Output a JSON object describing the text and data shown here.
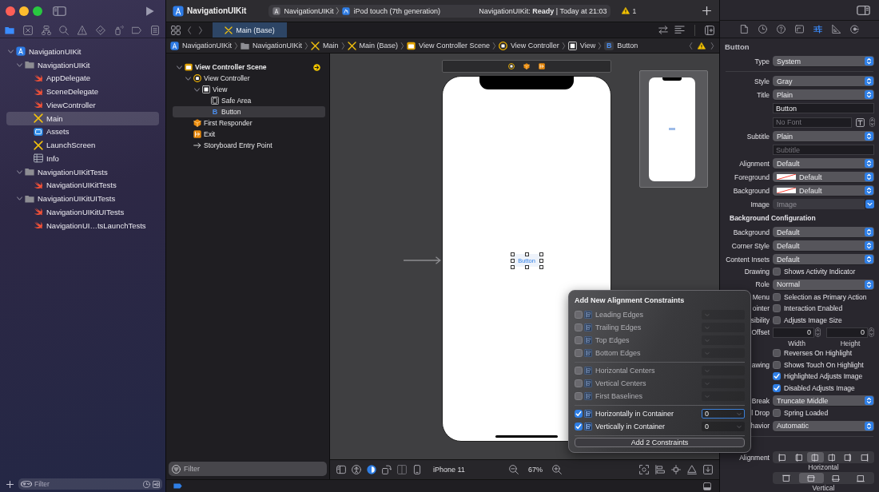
{
  "navigator": {
    "tabs": [
      {
        "kind": "project",
        "selected": true
      },
      {
        "kind": "source-control",
        "selected": false
      },
      {
        "kind": "symbols",
        "selected": false
      },
      {
        "kind": "find",
        "selected": false
      },
      {
        "kind": "issues",
        "selected": false
      },
      {
        "kind": "tests",
        "selected": false
      },
      {
        "kind": "debug",
        "selected": false
      },
      {
        "kind": "breakpoints",
        "selected": false
      },
      {
        "kind": "reports",
        "selected": false
      }
    ],
    "tree": [
      {
        "label": "NavigationUIKit",
        "kind": "project",
        "selected": false,
        "expanded": true,
        "children": [
          {
            "label": "NavigationUIKit",
            "kind": "folder",
            "selected": false,
            "expanded": true,
            "children": [
              {
                "label": "AppDelegate",
                "kind": "swift",
                "selected": false
              },
              {
                "label": "SceneDelegate",
                "kind": "swift",
                "selected": false
              },
              {
                "label": "ViewController",
                "kind": "swift",
                "selected": false
              },
              {
                "label": "Main",
                "kind": "storyboard",
                "selected": true
              },
              {
                "label": "Assets",
                "kind": "assets",
                "selected": false
              },
              {
                "label": "LaunchScreen",
                "kind": "storyboard",
                "selected": false
              },
              {
                "label": "Info",
                "kind": "plist",
                "selected": false
              }
            ]
          },
          {
            "label": "NavigationUIKitTests",
            "kind": "folder",
            "selected": false,
            "expanded": true,
            "children": [
              {
                "label": "NavigationUIKitTests",
                "kind": "swift",
                "selected": false
              }
            ]
          },
          {
            "label": "NavigationUIKitUITests",
            "kind": "folder",
            "selected": false,
            "expanded": true,
            "children": [
              {
                "label": "NavigationUIKitUITests",
                "kind": "swift",
                "selected": false
              },
              {
                "label": "NavigationUI…tsLaunchTests",
                "kind": "swift",
                "selected": false
              }
            ]
          }
        ]
      }
    ],
    "filter": {
      "placeholder": "Filter"
    }
  },
  "toolbar": {
    "title": "NavigationUIKit",
    "scheme": "NavigationUIKit",
    "destination": "iPod touch (7th generation)",
    "status": "NavigationUIKit: **Ready** | Today at 21:03",
    "warnings": "1"
  },
  "editor_tabs": [
    {
      "label": "Main (Base)",
      "selected": true
    }
  ],
  "jump_bar": [
    {
      "label": "NavigationUIKit",
      "kind": "project"
    },
    {
      "label": "NavigationUIKit",
      "kind": "folder"
    },
    {
      "label": "Main",
      "kind": "storyboard"
    },
    {
      "label": "Main (Base)",
      "kind": "storyboard"
    },
    {
      "label": "View Controller Scene",
      "kind": "scene"
    },
    {
      "label": "View Controller",
      "kind": "vc"
    },
    {
      "label": "View",
      "kind": "view"
    },
    {
      "label": "Button",
      "kind": "button",
      "glyph": "B"
    }
  ],
  "outline": {
    "tree": [
      {
        "label": "View Controller Scene",
        "kind": "scene",
        "selected": false,
        "expanded": true,
        "children": [
          {
            "label": "View Controller",
            "kind": "vc",
            "selected": false,
            "expanded": true,
            "children": [
              {
                "label": "View",
                "kind": "view",
                "selected": false,
                "expanded": true,
                "children": [
                  {
                    "label": "Safe Area",
                    "kind": "safearea",
                    "selected": false
                  },
                  {
                    "label": "Button",
                    "kind": "button",
                    "glyph": "B",
                    "selected": true
                  }
                ]
              }
            ]
          },
          {
            "label": "First Responder",
            "kind": "responder",
            "selected": false
          },
          {
            "label": "Exit",
            "kind": "exit",
            "selected": false
          },
          {
            "label": "Storyboard Entry Point",
            "kind": "entry",
            "selected": false
          }
        ]
      }
    ],
    "filter": {
      "placeholder": "Filter"
    }
  },
  "canvas": {
    "button_label": "Button",
    "device": "iPhone 11",
    "zoom": "67%"
  },
  "inspector": {
    "tabs": [
      {
        "kind": "file",
        "selected": false
      },
      {
        "kind": "history",
        "selected": false
      },
      {
        "kind": "help",
        "selected": false
      },
      {
        "kind": "identity",
        "selected": false
      },
      {
        "kind": "attributes",
        "selected": true
      },
      {
        "kind": "size",
        "selected": false
      },
      {
        "kind": "connections",
        "selected": false
      }
    ],
    "title": "Button",
    "rows": [
      {
        "kind": "popup",
        "label": "Type",
        "value": "System"
      },
      {
        "kind": "divider"
      },
      {
        "kind": "popup",
        "label": "Style",
        "value": "Gray"
      },
      {
        "kind": "popup",
        "label": "Title",
        "value": "Plain"
      },
      {
        "kind": "text",
        "value": "Button"
      },
      {
        "kind": "font",
        "placeholder": "No Font"
      },
      {
        "kind": "popup",
        "label": "Subtitle",
        "value": "Plain"
      },
      {
        "kind": "text",
        "placeholder": "Subtitle"
      },
      {
        "kind": "popup",
        "label": "Alignment",
        "value": "Default"
      },
      {
        "kind": "color",
        "label": "Foreground",
        "value": "Default"
      },
      {
        "kind": "color",
        "label": "Background",
        "value": "Default"
      },
      {
        "kind": "combo",
        "label": "Image",
        "placeholder": "Image"
      },
      {
        "kind": "section",
        "label": "Background Configuration"
      },
      {
        "kind": "popup",
        "label": "Background",
        "value": "Default"
      },
      {
        "kind": "popup",
        "label": "Corner Style",
        "value": "Default"
      },
      {
        "kind": "popup",
        "label": "Content Insets",
        "value": "Default"
      },
      {
        "kind": "checkbox",
        "label": "Drawing",
        "text": "Shows Activity Indicator",
        "checked": false
      },
      {
        "kind": "popup",
        "label": "Role",
        "value": "Normal"
      },
      {
        "kind": "checkbox",
        "label": "Menu",
        "text": "Selection as Primary Action",
        "checked": false
      },
      {
        "kind": "checkbox",
        "label": "ointer",
        "text": "Interaction Enabled",
        "checked": false
      },
      {
        "kind": "checkbox",
        "label": "sibility",
        "text": "Adjusts Image Size",
        "checked": false
      },
      {
        "kind": "steppers",
        "label": "Offset",
        "fields": [
          {
            "value": "0",
            "caption": "Width"
          },
          {
            "value": "0",
            "caption": "Height"
          }
        ]
      },
      {
        "kind": "checkbox",
        "text": "Reverses On Highlight",
        "checked": false
      },
      {
        "kind": "checkbox",
        "label": "awing",
        "text": "Shows Touch On Highlight",
        "checked": false
      },
      {
        "kind": "checkbox",
        "text": "Highlighted Adjusts Image",
        "checked": true
      },
      {
        "kind": "checkbox",
        "text": "Disabled Adjusts Image",
        "checked": true
      },
      {
        "kind": "popup",
        "label": "Break",
        "value": "Truncate Middle"
      },
      {
        "kind": "checkbox",
        "label": "l Drop",
        "text": "Spring Loaded",
        "checked": false
      },
      {
        "kind": "popup",
        "label": "havior",
        "value": "Automatic"
      },
      {
        "kind": "divider"
      },
      {
        "kind": "segmented",
        "label": "Alignment",
        "caption": "Horizontal",
        "segments": [
          {
            "selected": false
          },
          {
            "selected": false
          },
          {
            "selected": true
          },
          {
            "selected": false
          },
          {
            "selected": false
          },
          {
            "selected": false
          }
        ]
      },
      {
        "kind": "segmented",
        "caption": "Vertical",
        "segments": [
          {
            "selected": false
          },
          {
            "selected": true
          },
          {
            "selected": false
          },
          {
            "selected": false
          }
        ]
      }
    ]
  },
  "popup": {
    "title": "Add New Alignment Constraints",
    "groups": [
      {
        "rows": [
          {
            "label": "Leading Edges",
            "checked": false,
            "disabled": true,
            "focused": false
          },
          {
            "label": "Trailing Edges",
            "checked": false,
            "disabled": true,
            "focused": false
          },
          {
            "label": "Top Edges",
            "checked": false,
            "disabled": true,
            "focused": false
          },
          {
            "label": "Bottom Edges",
            "checked": false,
            "disabled": true,
            "focused": false
          }
        ]
      },
      {
        "rows": [
          {
            "label": "Horizontal Centers",
            "checked": false,
            "disabled": true,
            "focused": false
          },
          {
            "label": "Vertical Centers",
            "checked": false,
            "disabled": true,
            "focused": false
          },
          {
            "label": "First Baselines",
            "checked": false,
            "disabled": true,
            "focused": false
          }
        ]
      },
      {
        "rows": [
          {
            "label": "Horizontally in Container",
            "checked": true,
            "disabled": false,
            "focused": true,
            "value": "0"
          },
          {
            "label": "Vertically in Container",
            "checked": true,
            "disabled": false,
            "focused": false,
            "value": "0"
          }
        ]
      }
    ],
    "button": "Add 2 Constraints"
  }
}
